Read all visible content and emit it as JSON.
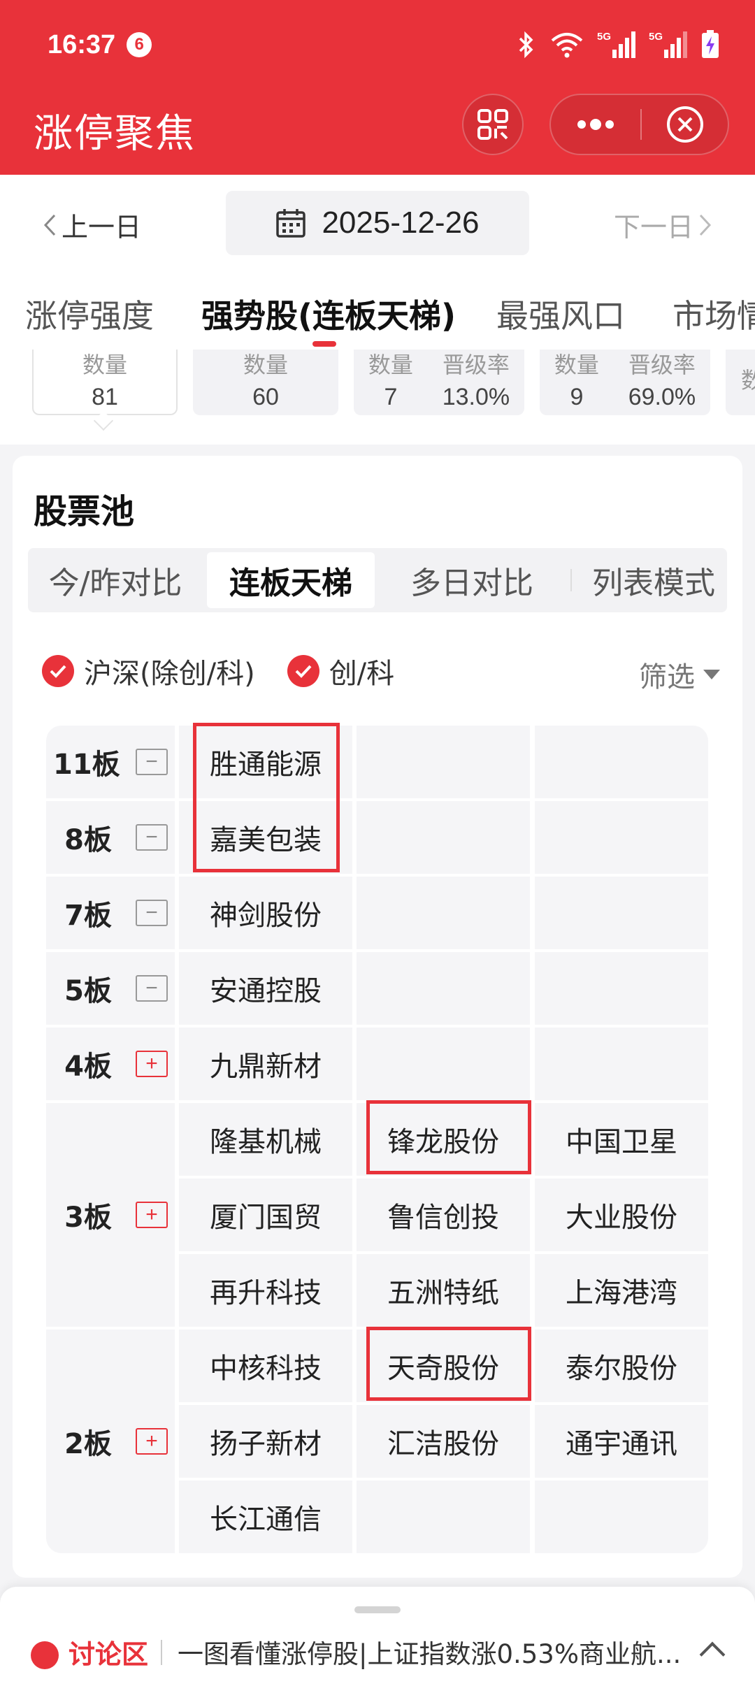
{
  "status_bar": {
    "time": "16:37",
    "notification_count": "6",
    "signal_label_1": "5G",
    "signal_label_2": "5G"
  },
  "app": {
    "title": "涨停聚焦"
  },
  "date_nav": {
    "prev_label": "上一日",
    "date": "2025-12-26",
    "next_label": "下一日"
  },
  "main_tabs": [
    {
      "label": "涨停强度",
      "active": false
    },
    {
      "label": "强势股(连板天梯)",
      "active": true
    },
    {
      "label": "最强风口",
      "active": false
    },
    {
      "label": "市场情",
      "active": false
    }
  ],
  "stat_cards": [
    {
      "items": [
        {
          "label": "数量",
          "value": "81"
        }
      ],
      "active": true
    },
    {
      "items": [
        {
          "label": "数量",
          "value": "60"
        }
      ],
      "active": false
    },
    {
      "items": [
        {
          "label": "数量",
          "value": "7"
        },
        {
          "label": "晋级率",
          "value": "13.0%"
        }
      ],
      "active": false
    },
    {
      "items": [
        {
          "label": "数量",
          "value": "9"
        },
        {
          "label": "晋级率",
          "value": "69.0%"
        }
      ],
      "active": false
    },
    {
      "items": [
        {
          "label": "数",
          "value": ""
        }
      ],
      "active": false
    }
  ],
  "pool": {
    "title": "股票池",
    "segments": [
      {
        "label": "今/昨对比",
        "active": false
      },
      {
        "label": "连板天梯",
        "active": true
      },
      {
        "label": "多日对比",
        "active": false
      },
      {
        "label": "列表模式",
        "active": false
      }
    ],
    "filters": {
      "market_main": "沪深(除创/科)",
      "market_growth": "创/科",
      "filter_label": "筛选"
    }
  },
  "ladder": [
    {
      "level": "11板",
      "toggle": "−",
      "stocks": [
        [
          "胜通能源"
        ]
      ]
    },
    {
      "level": "8板",
      "toggle": "−",
      "stocks": [
        [
          "嘉美包装"
        ]
      ]
    },
    {
      "level": "7板",
      "toggle": "−",
      "stocks": [
        [
          "神剑股份"
        ]
      ]
    },
    {
      "level": "5板",
      "toggle": "−",
      "stocks": [
        [
          "安通控股"
        ]
      ]
    },
    {
      "level": "4板",
      "toggle": "+",
      "stocks": [
        [
          "九鼎新材"
        ]
      ]
    },
    {
      "level": "3板",
      "toggle": "+",
      "stocks": [
        [
          "隆基机械",
          "锋龙股份",
          "中国卫星"
        ],
        [
          "厦门国贸",
          "鲁信创投",
          "大业股份"
        ],
        [
          "再升科技",
          "五洲特纸",
          "上海港湾"
        ]
      ]
    },
    {
      "level": "2板",
      "toggle": "+",
      "stocks": [
        [
          "中核科技",
          "天奇股份",
          "泰尔股份"
        ],
        [
          "扬子新材",
          "汇洁股份",
          "通宇通讯"
        ],
        [
          "长江通信"
        ]
      ]
    }
  ],
  "bottom": {
    "discussion_label": "讨论区",
    "headline": "一图看懂涨停股|上证指数涨0.53%商业航..."
  },
  "colors": {
    "brand_red": "#e8323a",
    "cell_bg": "#f5f5f7"
  }
}
